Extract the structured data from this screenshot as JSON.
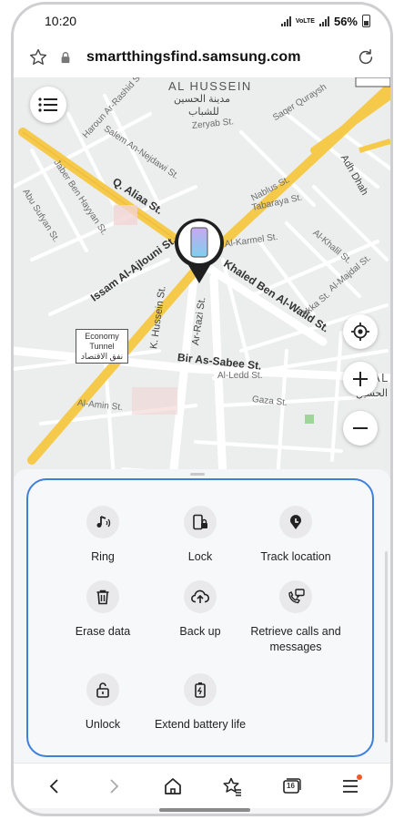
{
  "status_bar": {
    "time": "10:20",
    "network": "VoLTE",
    "battery": "56%"
  },
  "browser": {
    "url": "smartthingsfind.samsung.com"
  },
  "map": {
    "labels": {
      "district": "AL HUSSEIN",
      "district_ar_1": "مدينة الحسين",
      "district_ar_2": "للشباب",
      "district_right": "AL",
      "district_right_ar": "الحسين",
      "haroun": "Haroun Ar-Rashid St.",
      "salem": "Salem An-Nejdawi St.",
      "zeryab": "Zeryab St.",
      "saqer": "Saqer Quraysh",
      "adh_dhahab": "Adh Dhah",
      "jaber": "Jaber Ben Hayyan St.",
      "abu_sufyan": "Abu Sufyan St.",
      "q_aliaa": "Q. Aliaa St.",
      "issam": "Issam Al-Ajlouni St.",
      "nablus": "Nablus St.",
      "tabaraya": "Tabaraya St.",
      "karmel": "Al-Karmel St.",
      "khalil": "Al-Khalil St.",
      "khaled": "Khaled Ben Al-Walid St.",
      "hussein": "K. Hussein St.",
      "razi": "Ar-Razi St.",
      "majdal": "Al-Majdal St.",
      "akka": "Akka St.",
      "bir": "Bir As-Sabee St.",
      "ledd": "Al-Ledd St.",
      "gaza": "Gaza St.",
      "amin": "Al-Amin St.",
      "tunnel_1": "Economy",
      "tunnel_2": "Tunnel",
      "tunnel_ar": "نفق الاقتصاد"
    }
  },
  "actions": [
    {
      "id": "ring",
      "label": "Ring",
      "icon": "music-note-icon"
    },
    {
      "id": "lock",
      "label": "Lock",
      "icon": "phone-lock-icon"
    },
    {
      "id": "track",
      "label": "Track location",
      "icon": "location-pin-icon"
    },
    {
      "id": "erase",
      "label": "Erase data",
      "icon": "trash-icon"
    },
    {
      "id": "backup",
      "label": "Back up",
      "icon": "cloud-upload-icon"
    },
    {
      "id": "retrieve",
      "label": "Retrieve calls and messages",
      "icon": "call-message-icon"
    },
    {
      "id": "unlock",
      "label": "Unlock",
      "icon": "unlock-icon"
    },
    {
      "id": "battery",
      "label": "Extend battery life",
      "icon": "battery-icon"
    }
  ],
  "nav": {
    "tabs_count": "16"
  },
  "colors": {
    "accent_border": "#3d7fdc",
    "road_major": "#f5c94a",
    "notification_dot": "#f05a28"
  }
}
